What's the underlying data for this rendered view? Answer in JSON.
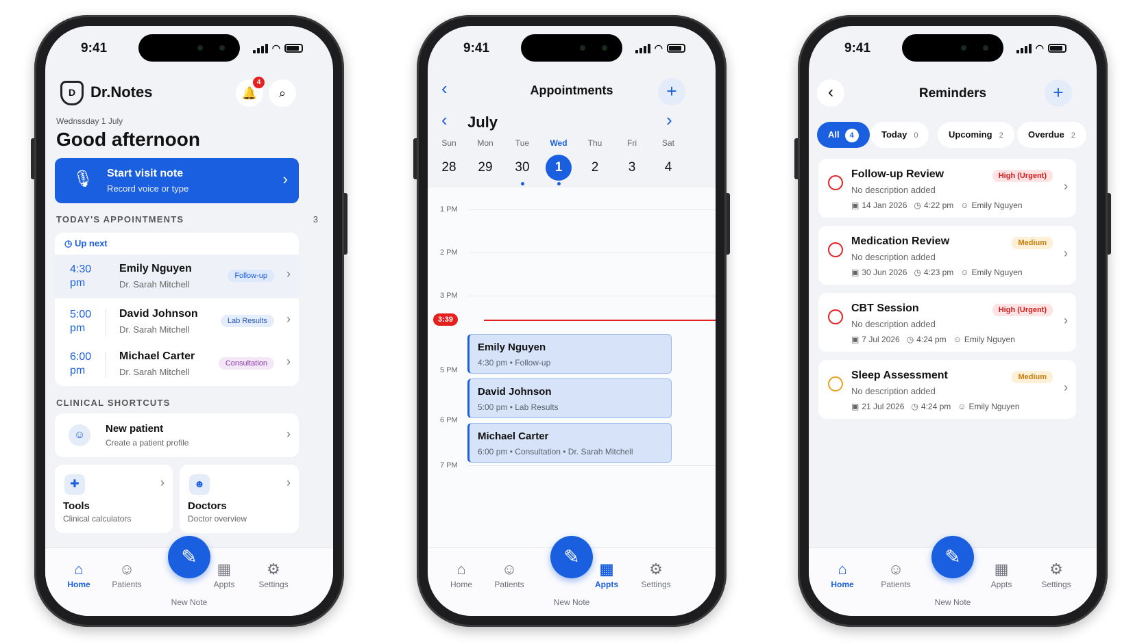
{
  "status": {
    "time": "9:41"
  },
  "home": {
    "brand": "Dr.Notes",
    "logo_text": "D",
    "notif_count": "4",
    "date": "Wednssday 1 July",
    "greeting": "Good afternoon",
    "start": {
      "title": "Start visit note",
      "subtitle": "Record voice or type"
    },
    "appts_header": "TODAY'S APPOINTMENTS",
    "appts_count": "3",
    "up_next": "Up next",
    "appointments": [
      {
        "hour": "4:30",
        "ampm": "pm",
        "name": "Emily Nguyen",
        "doctor": "Dr. Sarah Mitchell",
        "tag": "Follow-up"
      },
      {
        "hour": "5:00",
        "ampm": "pm",
        "name": "David Johnson",
        "doctor": "Dr. Sarah Mitchell",
        "tag": "Lab Results"
      },
      {
        "hour": "6:00",
        "ampm": "pm",
        "name": "Michael Carter",
        "doctor": "Dr. Sarah Mitchell",
        "tag": "Consultation"
      }
    ],
    "shortcuts_header": "CLINICAL SHORTCUTS",
    "new_patient": {
      "title": "New patient",
      "subtitle": "Create a patient profile"
    },
    "tools": {
      "title": "Tools",
      "subtitle": "Clinical calculators"
    },
    "doctors": {
      "title": "Doctors",
      "subtitle": "Doctor overview"
    }
  },
  "tabs": {
    "home": "Home",
    "patients": "Patients",
    "new_note": "New Note",
    "appts": "Appts",
    "settings": "Settings"
  },
  "appointments_screen": {
    "title": "Appointments",
    "month": "July",
    "days": [
      {
        "name": "Sun",
        "num": "28"
      },
      {
        "name": "Mon",
        "num": "29"
      },
      {
        "name": "Tue",
        "num": "30"
      },
      {
        "name": "Wed",
        "num": "1"
      },
      {
        "name": "Thu",
        "num": "2"
      },
      {
        "name": "Fri",
        "num": "3"
      },
      {
        "name": "Sat",
        "num": "4"
      }
    ],
    "hours": [
      "1 PM",
      "2 PM",
      "3 PM",
      "5 PM",
      "6 PM",
      "7 PM"
    ],
    "now": "3:39",
    "events": [
      {
        "name": "Emily Nguyen",
        "sub": "4:30 pm • Follow-up"
      },
      {
        "name": "David Johnson",
        "sub": "5:00 pm • Lab Results"
      },
      {
        "name": "Michael Carter",
        "sub": "6:00 pm • Consultation • Dr. Sarah Mitchell"
      }
    ]
  },
  "reminders": {
    "title": "Reminders",
    "filters": [
      {
        "label": "All",
        "count": "4"
      },
      {
        "label": "Today",
        "count": "0"
      },
      {
        "label": "Upcoming",
        "count": "2"
      },
      {
        "label": "Overdue",
        "count": "2"
      }
    ],
    "items": [
      {
        "title": "Follow-up Review",
        "desc": "No description added",
        "date": "14 Jan 2026",
        "time": "4:22 pm",
        "person": "Emily Nguyen",
        "priority": "High (Urgent)"
      },
      {
        "title": "Medication Review",
        "desc": "No description added",
        "date": "30 Jun 2026",
        "time": "4:23 pm",
        "person": "Emily Nguyen",
        "priority": "Medium"
      },
      {
        "title": "CBT Session",
        "desc": "No description added",
        "date": "7 Jul 2026",
        "time": "4:24 pm",
        "person": "Emily Nguyen",
        "priority": "High (Urgent)"
      },
      {
        "title": "Sleep Assessment",
        "desc": "No description added",
        "date": "21 Jul 2026",
        "time": "4:24 pm",
        "person": "Emily Nguyen",
        "priority": "Medium"
      }
    ]
  },
  "colors": {
    "accent": "#1a5fe0",
    "urgent": "#e52020",
    "medium": "#e8a020"
  }
}
